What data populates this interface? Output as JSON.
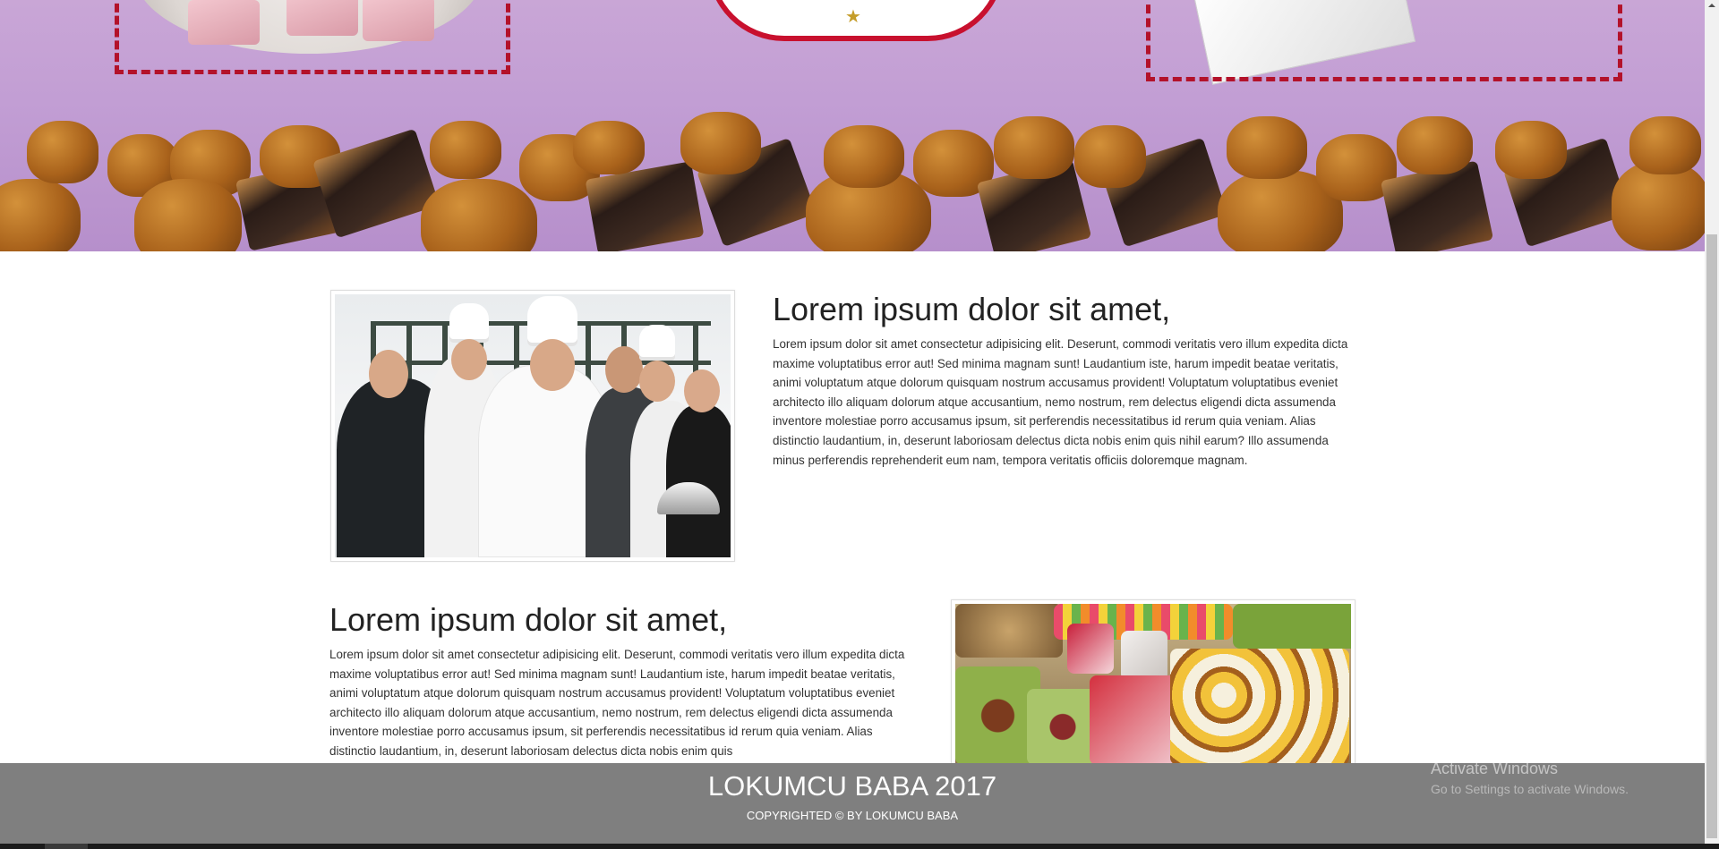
{
  "sections": [
    {
      "heading": "Lorem ipsum dolor sit amet,",
      "body": "Lorem ipsum dolor sit amet consectetur adipisicing elit. Deserunt, commodi veritatis vero illum expedita dicta maxime voluptatibus error aut! Sed minima magnam sunt! Laudantium iste, harum impedit beatae veritatis, animi voluptatum atque dolorum quisquam nostrum accusamus provident! Voluptatum voluptatibus eveniet architecto illo aliquam dolorum atque accusantium, nemo nostrum, rem delectus eligendi dicta assumenda inventore molestiae porro accusamus ipsum, sit perferendis necessitatibus id rerum quia veniam. Alias distinctio laudantium, in, deserunt laboriosam delectus dicta nobis enim quis nihil earum? Illo assumenda minus perferendis reprehenderit eum nam, tempora veritatis officiis doloremque magnam."
    },
    {
      "heading": "Lorem ipsum dolor sit amet,",
      "body": "Lorem ipsum dolor sit amet consectetur adipisicing elit. Deserunt, commodi veritatis vero illum expedita dicta maxime voluptatibus error aut! Sed minima magnam sunt! Laudantium iste, harum impedit beatae veritatis, animi voluptatum atque dolorum quisquam nostrum accusamus provident! Voluptatum voluptatibus eveniet architecto illo aliquam dolorum atque accusantium, nemo nostrum, rem delectus eligendi dicta assumenda inventore molestiae porro accusamus ipsum, sit perferendis necessitatibus id rerum quia veniam. Alias distinctio laudantium, in, deserunt laboriosam delectus dicta nobis enim quis"
    }
  ],
  "footer": {
    "title": "LOKUMCU BABA 2017",
    "copyright": "COPYRIGHTED © BY LOKUMCU BABA"
  },
  "os_watermark": {
    "title": "Activate Windows",
    "subtitle": "Go to Settings to activate Windows."
  },
  "colors": {
    "hero_purple": "#c29ed4",
    "frame_red": "#b3122a",
    "footer_gray": "#7f7f7f"
  }
}
